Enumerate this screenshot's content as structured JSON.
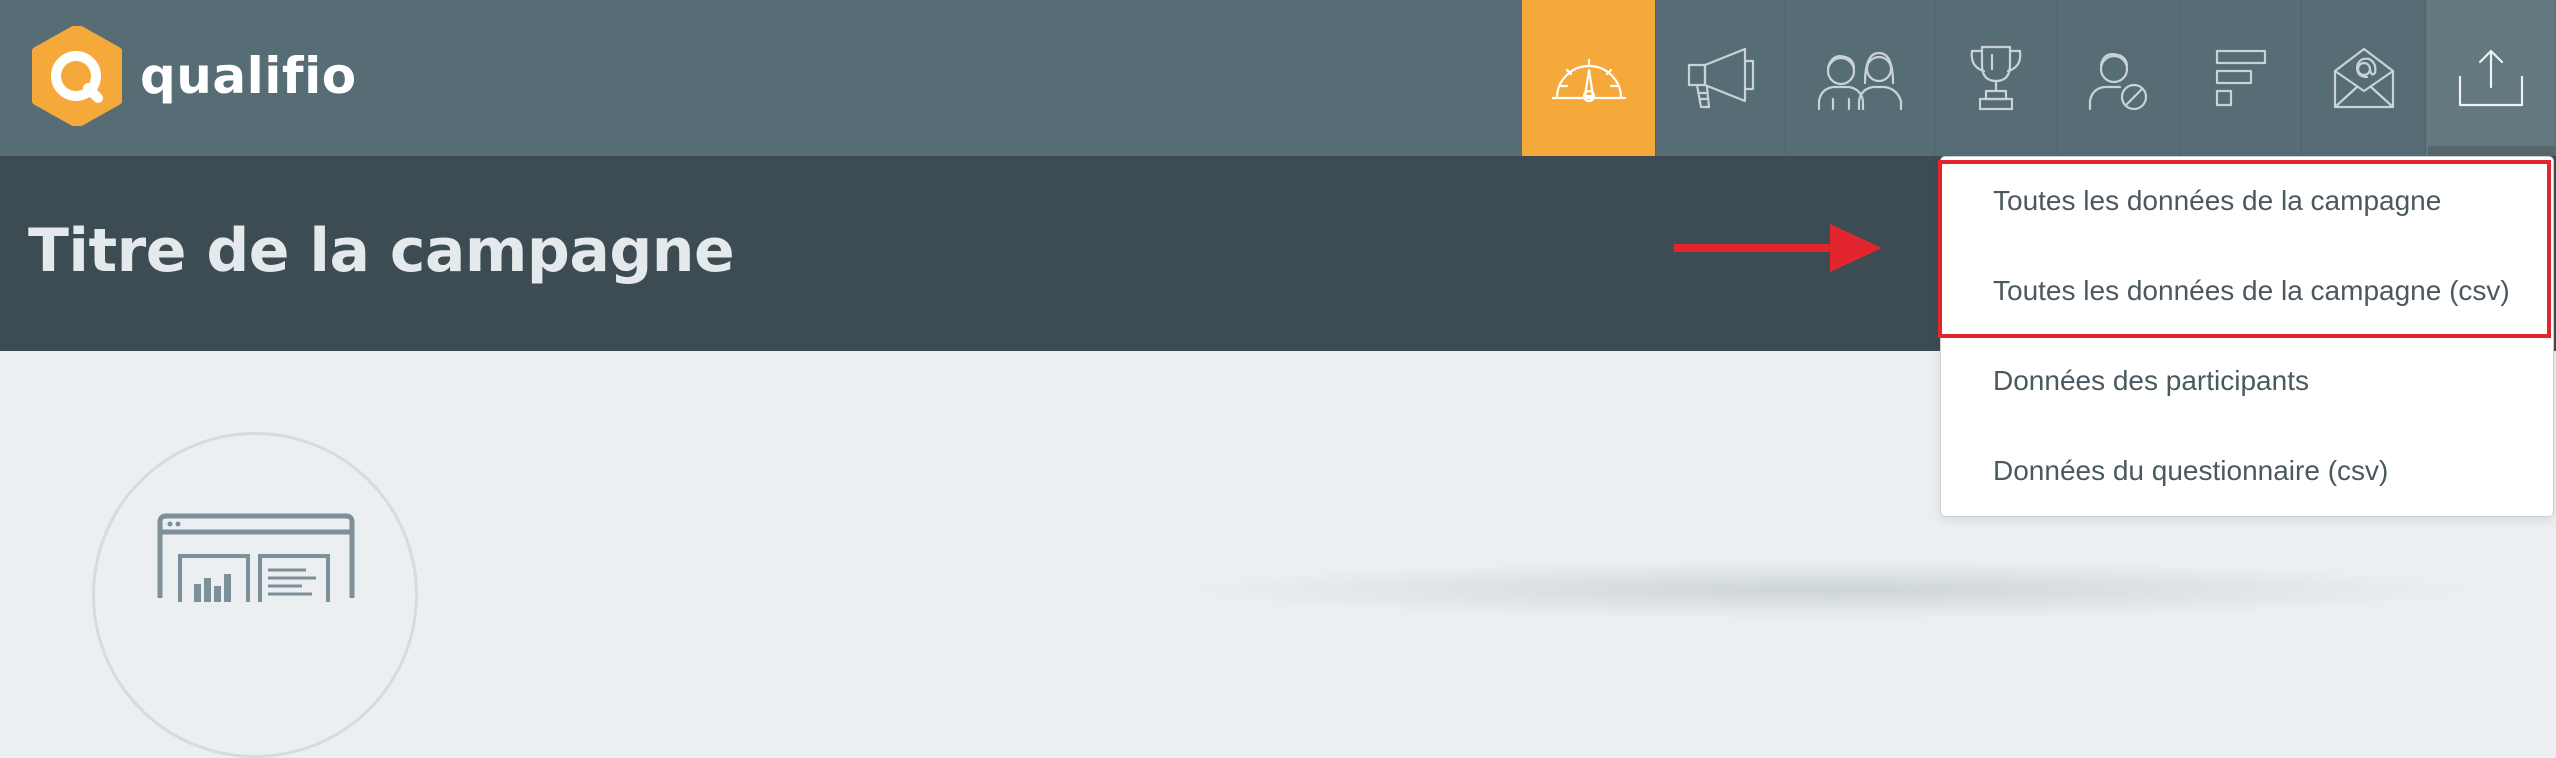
{
  "brand": {
    "name": "qualifio",
    "logo_color": "#f5a93b"
  },
  "topbar": {
    "icons": [
      {
        "name": "dashboard-gauge-icon",
        "active": true
      },
      {
        "name": "megaphone-icon",
        "active": false
      },
      {
        "name": "participants-icon",
        "active": false
      },
      {
        "name": "trophy-icon",
        "active": false
      },
      {
        "name": "user-blocked-icon",
        "active": false
      },
      {
        "name": "steps-flow-icon",
        "active": false
      },
      {
        "name": "email-icon",
        "active": false
      },
      {
        "name": "export-upload-icon",
        "active": false
      }
    ],
    "background": "#566d76",
    "active_color": "#f5a93b"
  },
  "header": {
    "title": "Titre de la campagne"
  },
  "export_menu": {
    "items": [
      {
        "label": "Toutes les données de la campagne",
        "highlighted": true
      },
      {
        "label": "Toutes les données de la campagne (csv)",
        "highlighted": true
      },
      {
        "label": "Données des participants",
        "highlighted": false
      },
      {
        "label": "Données du questionnaire (csv)",
        "highlighted": false
      }
    ]
  },
  "annotation": {
    "arrow_color": "#e3262d",
    "highlight_color": "#e3262d"
  }
}
